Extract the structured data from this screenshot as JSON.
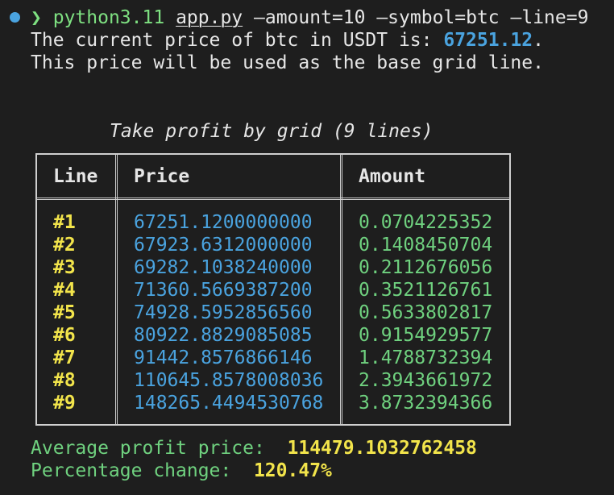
{
  "prompt": {
    "chevron": "❯",
    "command": "python3.11",
    "file": "app.py",
    "args": "—amount=10 —symbol=btc —line=9"
  },
  "output": {
    "line1_prefix": "The current price of btc in USDT is: ",
    "line1_price": "67251.12",
    "line1_suffix": ".",
    "line2": "This price will be used as the base grid line."
  },
  "table": {
    "title": "Take profit by grid (9 lines)",
    "columns": [
      "Line",
      "Price",
      "Amount"
    ],
    "rows": [
      {
        "line": "#1",
        "price": "67251.1200000000",
        "amount": "0.0704225352"
      },
      {
        "line": "#2",
        "price": "67923.6312000000",
        "amount": "0.1408450704"
      },
      {
        "line": "#3",
        "price": "69282.1038240000",
        "amount": "0.2112676056"
      },
      {
        "line": "#4",
        "price": "71360.5669387200",
        "amount": "0.3521126761"
      },
      {
        "line": "#5",
        "price": "74928.5952856560",
        "amount": "0.5633802817"
      },
      {
        "line": "#6",
        "price": "80922.8829085085",
        "amount": "0.9154929577"
      },
      {
        "line": "#7",
        "price": "91442.8576866146",
        "amount": "1.4788732394"
      },
      {
        "line": "#8",
        "price": "110645.8578008036",
        "amount": "2.3943661972"
      },
      {
        "line": "#9",
        "price": "148265.4494530768",
        "amount": "3.8732394366"
      }
    ]
  },
  "summary": {
    "avg_label": "Average profit price:  ",
    "avg_value": "114479.1032762458",
    "pct_label": "Percentage change:  ",
    "pct_value": "120.47%"
  },
  "colors": {
    "background": "#1e1e1e",
    "green": "#7ee081",
    "blue": "#4aa3df",
    "yellow": "#f2e44b",
    "teal_green": "#6fd17f"
  }
}
